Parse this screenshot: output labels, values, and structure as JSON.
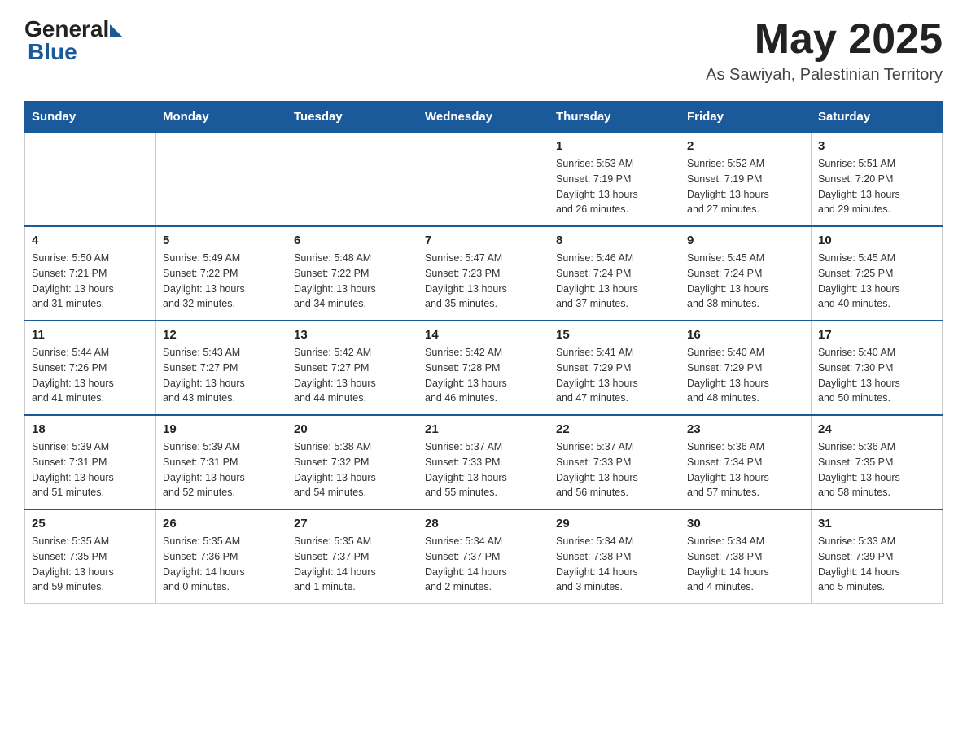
{
  "header": {
    "logo_general": "General",
    "logo_blue": "Blue",
    "month_year": "May 2025",
    "location": "As Sawiyah, Palestinian Territory"
  },
  "days_of_week": [
    "Sunday",
    "Monday",
    "Tuesday",
    "Wednesday",
    "Thursday",
    "Friday",
    "Saturday"
  ],
  "weeks": [
    [
      {
        "day": "",
        "info": ""
      },
      {
        "day": "",
        "info": ""
      },
      {
        "day": "",
        "info": ""
      },
      {
        "day": "",
        "info": ""
      },
      {
        "day": "1",
        "info": "Sunrise: 5:53 AM\nSunset: 7:19 PM\nDaylight: 13 hours\nand 26 minutes."
      },
      {
        "day": "2",
        "info": "Sunrise: 5:52 AM\nSunset: 7:19 PM\nDaylight: 13 hours\nand 27 minutes."
      },
      {
        "day": "3",
        "info": "Sunrise: 5:51 AM\nSunset: 7:20 PM\nDaylight: 13 hours\nand 29 minutes."
      }
    ],
    [
      {
        "day": "4",
        "info": "Sunrise: 5:50 AM\nSunset: 7:21 PM\nDaylight: 13 hours\nand 31 minutes."
      },
      {
        "day": "5",
        "info": "Sunrise: 5:49 AM\nSunset: 7:22 PM\nDaylight: 13 hours\nand 32 minutes."
      },
      {
        "day": "6",
        "info": "Sunrise: 5:48 AM\nSunset: 7:22 PM\nDaylight: 13 hours\nand 34 minutes."
      },
      {
        "day": "7",
        "info": "Sunrise: 5:47 AM\nSunset: 7:23 PM\nDaylight: 13 hours\nand 35 minutes."
      },
      {
        "day": "8",
        "info": "Sunrise: 5:46 AM\nSunset: 7:24 PM\nDaylight: 13 hours\nand 37 minutes."
      },
      {
        "day": "9",
        "info": "Sunrise: 5:45 AM\nSunset: 7:24 PM\nDaylight: 13 hours\nand 38 minutes."
      },
      {
        "day": "10",
        "info": "Sunrise: 5:45 AM\nSunset: 7:25 PM\nDaylight: 13 hours\nand 40 minutes."
      }
    ],
    [
      {
        "day": "11",
        "info": "Sunrise: 5:44 AM\nSunset: 7:26 PM\nDaylight: 13 hours\nand 41 minutes."
      },
      {
        "day": "12",
        "info": "Sunrise: 5:43 AM\nSunset: 7:27 PM\nDaylight: 13 hours\nand 43 minutes."
      },
      {
        "day": "13",
        "info": "Sunrise: 5:42 AM\nSunset: 7:27 PM\nDaylight: 13 hours\nand 44 minutes."
      },
      {
        "day": "14",
        "info": "Sunrise: 5:42 AM\nSunset: 7:28 PM\nDaylight: 13 hours\nand 46 minutes."
      },
      {
        "day": "15",
        "info": "Sunrise: 5:41 AM\nSunset: 7:29 PM\nDaylight: 13 hours\nand 47 minutes."
      },
      {
        "day": "16",
        "info": "Sunrise: 5:40 AM\nSunset: 7:29 PM\nDaylight: 13 hours\nand 48 minutes."
      },
      {
        "day": "17",
        "info": "Sunrise: 5:40 AM\nSunset: 7:30 PM\nDaylight: 13 hours\nand 50 minutes."
      }
    ],
    [
      {
        "day": "18",
        "info": "Sunrise: 5:39 AM\nSunset: 7:31 PM\nDaylight: 13 hours\nand 51 minutes."
      },
      {
        "day": "19",
        "info": "Sunrise: 5:39 AM\nSunset: 7:31 PM\nDaylight: 13 hours\nand 52 minutes."
      },
      {
        "day": "20",
        "info": "Sunrise: 5:38 AM\nSunset: 7:32 PM\nDaylight: 13 hours\nand 54 minutes."
      },
      {
        "day": "21",
        "info": "Sunrise: 5:37 AM\nSunset: 7:33 PM\nDaylight: 13 hours\nand 55 minutes."
      },
      {
        "day": "22",
        "info": "Sunrise: 5:37 AM\nSunset: 7:33 PM\nDaylight: 13 hours\nand 56 minutes."
      },
      {
        "day": "23",
        "info": "Sunrise: 5:36 AM\nSunset: 7:34 PM\nDaylight: 13 hours\nand 57 minutes."
      },
      {
        "day": "24",
        "info": "Sunrise: 5:36 AM\nSunset: 7:35 PM\nDaylight: 13 hours\nand 58 minutes."
      }
    ],
    [
      {
        "day": "25",
        "info": "Sunrise: 5:35 AM\nSunset: 7:35 PM\nDaylight: 13 hours\nand 59 minutes."
      },
      {
        "day": "26",
        "info": "Sunrise: 5:35 AM\nSunset: 7:36 PM\nDaylight: 14 hours\nand 0 minutes."
      },
      {
        "day": "27",
        "info": "Sunrise: 5:35 AM\nSunset: 7:37 PM\nDaylight: 14 hours\nand 1 minute."
      },
      {
        "day": "28",
        "info": "Sunrise: 5:34 AM\nSunset: 7:37 PM\nDaylight: 14 hours\nand 2 minutes."
      },
      {
        "day": "29",
        "info": "Sunrise: 5:34 AM\nSunset: 7:38 PM\nDaylight: 14 hours\nand 3 minutes."
      },
      {
        "day": "30",
        "info": "Sunrise: 5:34 AM\nSunset: 7:38 PM\nDaylight: 14 hours\nand 4 minutes."
      },
      {
        "day": "31",
        "info": "Sunrise: 5:33 AM\nSunset: 7:39 PM\nDaylight: 14 hours\nand 5 minutes."
      }
    ]
  ]
}
